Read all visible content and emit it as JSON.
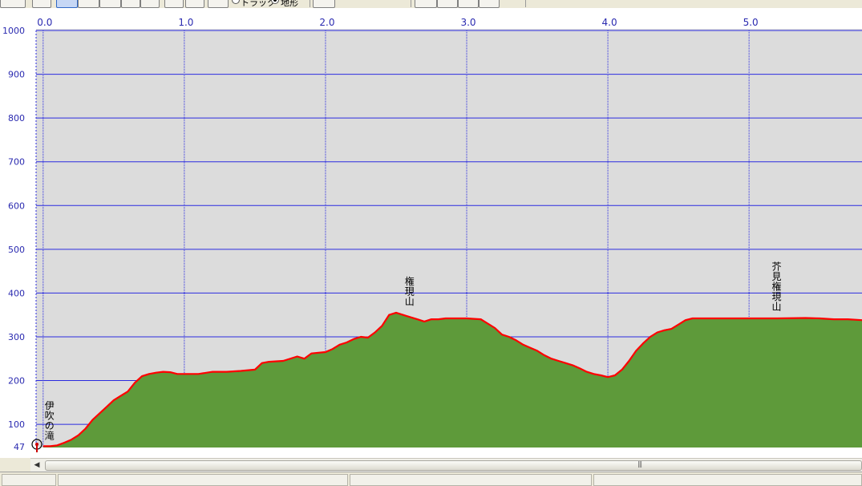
{
  "toolbar": {
    "radio_track": "トラック",
    "radio_terrain": "地形",
    "radio_track_selected": false,
    "radio_terrain_selected": true,
    "icons": [
      "zoom-icon",
      "circle-tool-icon",
      "line-chart-icon",
      "ruler-icon",
      "window-icon",
      "hand-icon",
      "image-icon",
      "gear-icon",
      "gear-icon",
      "checklist-icon",
      "elevation-icon",
      "3d-icon",
      "left-arrow-icon",
      "box-icon",
      "right-arrow-icon"
    ]
  },
  "chart_data": {
    "type": "area",
    "xlim": [
      -0.05,
      5.8
    ],
    "ylim": [
      47,
      1000
    ],
    "x_ticks": [
      0.0,
      1.0,
      2.0,
      3.0,
      4.0,
      5.0
    ],
    "x_tick_labels": [
      "0.0",
      "1.0",
      "2.0",
      "3.0",
      "4.0",
      "5.0"
    ],
    "y_ticks": [
      100,
      200,
      300,
      400,
      500,
      600,
      700,
      800,
      900,
      1000
    ],
    "y_tick_labels": [
      "100",
      "200",
      "300",
      "400",
      "500",
      "600",
      "700",
      "800",
      "900",
      "1000"
    ],
    "y_min_label": "47",
    "grid": true,
    "colors": {
      "fill": "#5e9a3a",
      "line": "#ff0000",
      "grid": "#2b2be0",
      "background": "#dcdcdc",
      "axis_text": "#2a2ab0"
    },
    "series": [
      {
        "x": [
          0.0,
          0.05,
          0.1,
          0.15,
          0.2,
          0.25,
          0.3,
          0.35,
          0.4,
          0.45,
          0.5,
          0.55,
          0.6,
          0.65,
          0.7,
          0.75,
          0.8,
          0.85,
          0.9,
          0.95,
          1.0,
          1.1,
          1.2,
          1.3,
          1.4,
          1.5,
          1.55,
          1.6,
          1.7,
          1.8,
          1.85,
          1.9,
          2.0,
          2.05,
          2.1,
          2.15,
          2.2,
          2.25,
          2.3,
          2.35,
          2.4,
          2.45,
          2.5,
          2.55,
          2.6,
          2.65,
          2.7,
          2.75,
          2.8,
          2.85,
          2.9,
          3.0,
          3.1,
          3.2,
          3.25,
          3.3,
          3.35,
          3.4,
          3.45,
          3.5,
          3.55,
          3.6,
          3.65,
          3.7,
          3.75,
          3.8,
          3.85,
          3.9,
          3.95,
          4.0,
          4.05,
          4.1,
          4.15,
          4.2,
          4.25,
          4.3,
          4.35,
          4.4,
          4.45,
          4.5,
          4.55,
          4.6,
          4.7,
          4.8,
          5.0,
          5.2,
          5.4,
          5.5,
          5.6,
          5.7,
          5.8
        ],
        "y": [
          50,
          50,
          52,
          58,
          65,
          75,
          90,
          110,
          125,
          140,
          155,
          165,
          175,
          195,
          210,
          215,
          218,
          220,
          219,
          215,
          215,
          215,
          220,
          220,
          222,
          225,
          240,
          243,
          245,
          255,
          250,
          262,
          265,
          272,
          282,
          287,
          295,
          300,
          298,
          310,
          325,
          350,
          355,
          350,
          345,
          340,
          335,
          340,
          340,
          342,
          342,
          342,
          340,
          320,
          305,
          300,
          292,
          282,
          275,
          268,
          258,
          250,
          245,
          240,
          235,
          228,
          220,
          215,
          212,
          208,
          212,
          225,
          245,
          268,
          285,
          300,
          310,
          315,
          318,
          328,
          338,
          342,
          342,
          342,
          342,
          342,
          343,
          342,
          340,
          340,
          338
        ]
      }
    ],
    "annotations": [
      {
        "x": 0.0,
        "y": 48,
        "label": "伊吹の滝"
      },
      {
        "x": 2.55,
        "y": 355,
        "label": "権現山"
      },
      {
        "x": 5.15,
        "y": 343,
        "label": "芥見権現山"
      }
    ]
  }
}
